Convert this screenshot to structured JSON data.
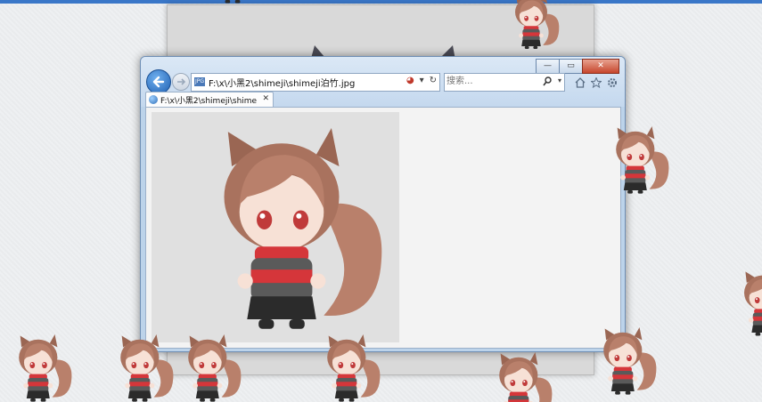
{
  "desktop": {
    "accent": "#3a77c8"
  },
  "window": {
    "caption": {
      "minimize": "—",
      "maximize": "▭",
      "close": "✕"
    },
    "address": {
      "value": "F:\\x\\小黑2\\shimeji\\shimeji泊竹.jpg",
      "icon_text": "JPG"
    },
    "search": {
      "placeholder": "搜索..."
    },
    "tab": {
      "label": "F:\\x\\小黑2\\shimeji\\shimeji...",
      "close": "✕"
    },
    "toolbar_icons": [
      "home-icon",
      "favorites-star-icon",
      "settings-gear-icon"
    ]
  },
  "content": {
    "image": "chibi squirrel-girl character with brown hair, red eyes, red scarf and black outfit"
  },
  "colors": {
    "hair": "#b9806b",
    "hair_dark": "#8f5a47",
    "skin": "#f7e1d6",
    "red": "#d5363a",
    "black": "#2b2b2b"
  }
}
